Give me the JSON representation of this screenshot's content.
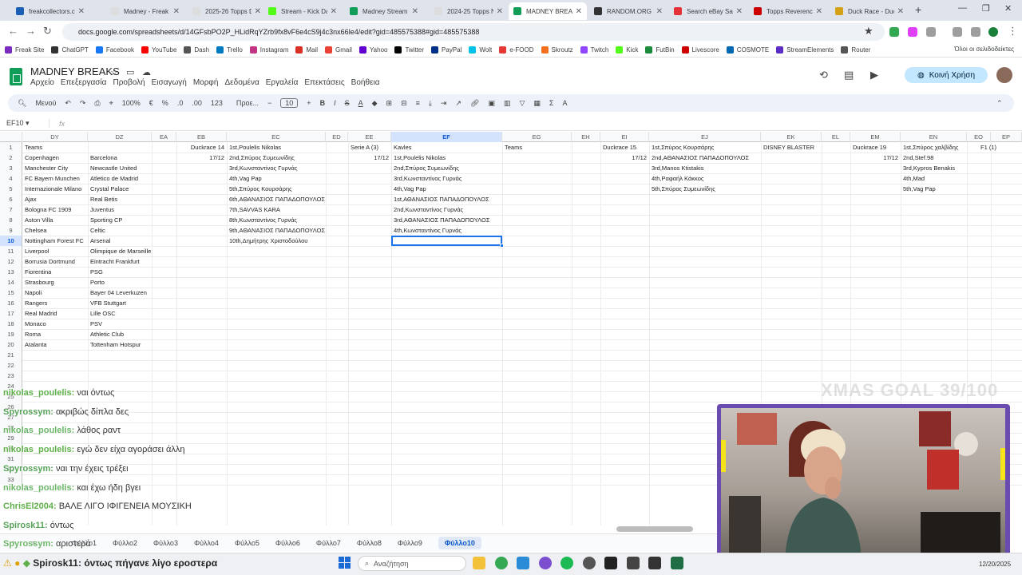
{
  "browser": {
    "tabs": [
      {
        "title": "freakcollectors.co",
        "color": "#1a5fb4"
      },
      {
        "title": "Madney - Freak C",
        "color": "#dddddd"
      },
      {
        "title": "2025-26 Topps D",
        "color": "#dddddd"
      },
      {
        "title": "Stream - Kick Da",
        "color": "#53fc18"
      },
      {
        "title": "Madney Stream",
        "color": "#0f9d58"
      },
      {
        "title": "2024-25 Topps N",
        "color": "#dddddd"
      },
      {
        "title": "MADNEY BREAK",
        "color": "#0f9d58"
      },
      {
        "title": "RANDOM.ORG",
        "color": "#333333"
      },
      {
        "title": "Search eBay Sale",
        "color": "#e53238"
      },
      {
        "title": "Topps Reverence",
        "color": "#c00"
      },
      {
        "title": "Duck Race - Duc",
        "color": "#d4a017"
      }
    ],
    "url": "docs.google.com/spreadsheets/d/14GFsbPO2P_HLidRqYZrb9fx8vF6e4cS9j4c3nx66le4/edit?gid=485575388#gid=485575388",
    "bookmarks": [
      "Freak Site",
      "ChatGPT",
      "Facebook",
      "YouTube",
      "Dash",
      "Trello",
      "Instagram",
      "Mail",
      "Gmail",
      "Yahoo",
      "Twitter",
      "PayPal",
      "Wolt",
      "e-FOOD",
      "Skroutz",
      "Twitch",
      "Kick",
      "FutBin",
      "Livescore",
      "COSMOTE",
      "StreamElements",
      "Router"
    ],
    "other_bookmarks": "Όλοι οι σελιδοδείκτες"
  },
  "sheets": {
    "title": "MADNEY BREAKS",
    "menu": [
      "Αρχείο",
      "Επεξεργασία",
      "Προβολή",
      "Εισαγωγή",
      "Μορφή",
      "Δεδομένα",
      "Εργαλεία",
      "Επεκτάσεις",
      "Βοήθεια"
    ],
    "share_label": "Κοινή Χρήση",
    "toolbar": {
      "search": "Μενού",
      "zoom": "100%",
      "currency": "€",
      "percent": "%",
      "dec_minus": ".0",
      "dec_plus": ".00",
      "num_format": "123",
      "font": "Προε...",
      "font_size": "10"
    },
    "name_box": "EF10",
    "fx": "fx",
    "columns": [
      "DY",
      "DZ",
      "EA",
      "EB",
      "EC",
      "ED",
      "EE",
      "EF",
      "EG",
      "EH",
      "EI",
      "EJ",
      "EK",
      "EL",
      "EM",
      "EN",
      "EO",
      "EP"
    ],
    "selected_column": "EF",
    "selected_row": "10",
    "rows": [
      "1",
      "2",
      "3",
      "4",
      "5",
      "6",
      "7",
      "8",
      "9",
      "10",
      "11",
      "12",
      "13",
      "14",
      "15",
      "16",
      "17",
      "18",
      "19",
      "20",
      "21",
      "22",
      "23",
      "24",
      "25",
      "26",
      "27",
      "28",
      "29",
      "30",
      "31",
      "32",
      "33"
    ],
    "col_dy": [
      "Teams",
      "Copenhagen",
      "Manchester City",
      "FC Bayern Munchen",
      "Internazionale Milano",
      "Ajax",
      "Bologna FC 1909",
      "Aston Villa",
      "Chelsea",
      "Nottingham Forest FC",
      "Liverpool",
      "Borrusia Dortmund",
      "Fiorentina",
      "Strasbourg",
      "Napoli",
      "Rangers",
      "Real Madrid",
      "Monaco",
      "Roma",
      "Atalanta"
    ],
    "col_dz": [
      "",
      "Barcelona",
      "Newcastle United",
      "Atletico de Madrid",
      "Crystal Palace",
      "Real Betis",
      "Juventus",
      "Sporting CP",
      "Celtic",
      "Arsenal",
      "Olimpique de Marseille",
      "Eintracht Frankfurt",
      "PSG",
      "Porto",
      "Bayer 04 Leverkuzen",
      "VFB Stuttgart",
      "Lille OSC",
      "PSV",
      "Athletic Club",
      "Tottenham Hotspur"
    ],
    "col_eb": [
      "Duckrace 14",
      "17/12"
    ],
    "col_ec": [
      "1st,Poulelis Nikolas",
      "2nd,Σπύρος Συμεωνίδης",
      "3rd,Κωνσταντίνος Γυρνάς",
      "4th,Vag Pap",
      "5th,Σπύρος Κουρσάρης",
      "6th,ΑΘΑΝΑΣΙΟΣ ΠΑΠΑΔΟΠΟΥΛΟΣ",
      "7th,SAVVAS KARA",
      "8th,Κωνσταντίνος Γυρνάς",
      "9th,ΑΘΑΝΑΣΙΟΣ ΠΑΠΑΔΟΠΟΥΛΟΣ",
      "10th,Δημήτρης Χριστοδούλου"
    ],
    "col_ee": [
      "Serie A (3)",
      "17/12"
    ],
    "col_ef": [
      "Kavles",
      "1st,Poulelis Nikolas",
      "2nd,Σπύρος Συμεωνίδης",
      "3rd,Κωνσταντίνος Γυρνάς",
      "4th,Vag Pap",
      "1st,ΑΘΑΝΑΣΙΟΣ ΠΑΠΑΔΟΠΟΥΛΟΣ",
      "2nd,Κωνσταντίνος Γυρνάς",
      "3rd,ΑΘΑΝΑΣΙΟΣ ΠΑΠΑΔΟΠΟΥΛΟΣ",
      "4th,Κωνσταντίνος Γυρνάς"
    ],
    "col_eg": [
      "Teams"
    ],
    "col_ei": [
      "Duckrace 15",
      "17/12"
    ],
    "col_ej": [
      "1st,Σπύρος Κουρσάρης",
      "2nd,ΑΘΑΝΑΣΙΟΣ ΠΑΠΑΔΟΠΟΥΛΟΣ",
      "3rd,Manos Ktistakis",
      "4th,Ραφαήλ Κάκκος",
      "5th,Σπύρος Συμεωνίδης"
    ],
    "col_ek": [
      "DISNEY BLASTER"
    ],
    "col_em": [
      "Duckrace 19",
      "17/12"
    ],
    "col_en": [
      "1st,Σπύρος χαλβίδης",
      "2nd,Stef.98",
      "3rd,Kypros Benakis",
      "4th,Mad",
      "5th,Vag Pap"
    ],
    "col_eo": [
      "F1 (1)"
    ],
    "sheet_tabs": [
      "Φύλλο1",
      "Φύλλο2",
      "Φύλλο3",
      "Φύλλο4",
      "Φύλλο5",
      "Φύλλο6",
      "Φύλλο7",
      "Φύλλο8",
      "Φύλλο9",
      "Φύλλο10"
    ],
    "active_sheet": "Φύλλο10"
  },
  "stream_overlay": {
    "chat": [
      {
        "user": "nikolas_poulelis:",
        "msg": "ναι όντως"
      },
      {
        "user": "Spyrossym:",
        "msg": "ακριβώς δίπλα δες"
      },
      {
        "user": "nikolas_poulelis:",
        "msg": "λάθος ραντ"
      },
      {
        "user": "nikolas_poulelis:",
        "msg": "εγώ δεν είχα αγοράσει άλλη"
      },
      {
        "user": "Spyrossym:",
        "msg": "ναι την έχεις τρέξει"
      },
      {
        "user": "nikolas_poulelis:",
        "msg": "και έχω ήδη βγει"
      },
      {
        "user": "ChrisEl2004:",
        "msg": "ΒΑΛΕ ΛΙΓΟ ΙΦΙΓΕΝΕΙΑ ΜΟΥΣΙΚΗ"
      },
      {
        "user": "Spirosk11:",
        "msg": "όντως"
      },
      {
        "user": "Spyrossym:",
        "msg": "αριστερά"
      }
    ],
    "goal": "XMAS GOAL 39/100",
    "bottom_chat_user": "Spirosk11:",
    "bottom_chat_msg": "όντως πήγανε λίγο εροστερα"
  },
  "taskbar": {
    "search_placeholder": "Αναζήτηση",
    "date": "12/20/2025"
  }
}
